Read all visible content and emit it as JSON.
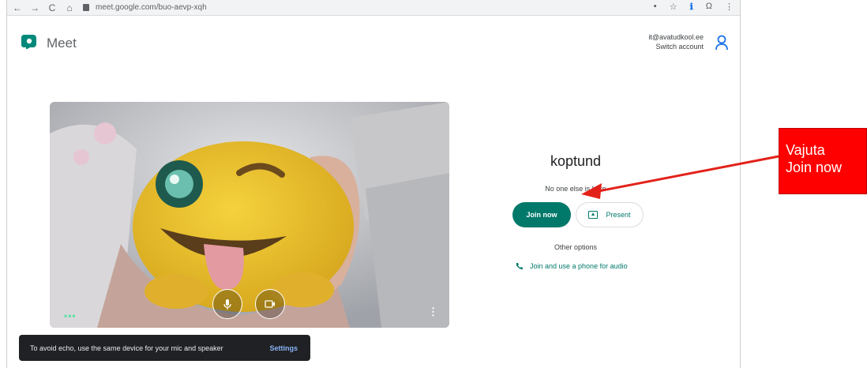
{
  "browser": {
    "nav_back": "←",
    "nav_forward": "→",
    "nav_reload": "C",
    "nav_home": "⌂",
    "url": "meet.google.com/buo-aevp-xqh",
    "right_icons": [
      "▪",
      "☆",
      "ℹ",
      "Ω",
      "⋮"
    ]
  },
  "header": {
    "app_name": "Meet",
    "account_email": "it@avatudkool.ee",
    "switch_account": "Switch account"
  },
  "preview": {
    "dots": "•••",
    "kebab": "⋮"
  },
  "join_panel": {
    "meeting_name": "koptund",
    "status": "No one else is here",
    "join_label": "Join now",
    "present_label": "Present",
    "other_options": "Other options",
    "phone_option": "Join and use a phone for audio"
  },
  "toast": {
    "message": "To avoid echo, use the same device for your mic and speaker",
    "action": "Settings"
  },
  "annotation": {
    "text": "Vajuta\nJoin now",
    "box_color": "#ff0000",
    "arrow_color": "#e32119"
  },
  "colors": {
    "accent": "#00796b",
    "toast_bg": "#202124",
    "toast_action": "#8ab4f8"
  }
}
